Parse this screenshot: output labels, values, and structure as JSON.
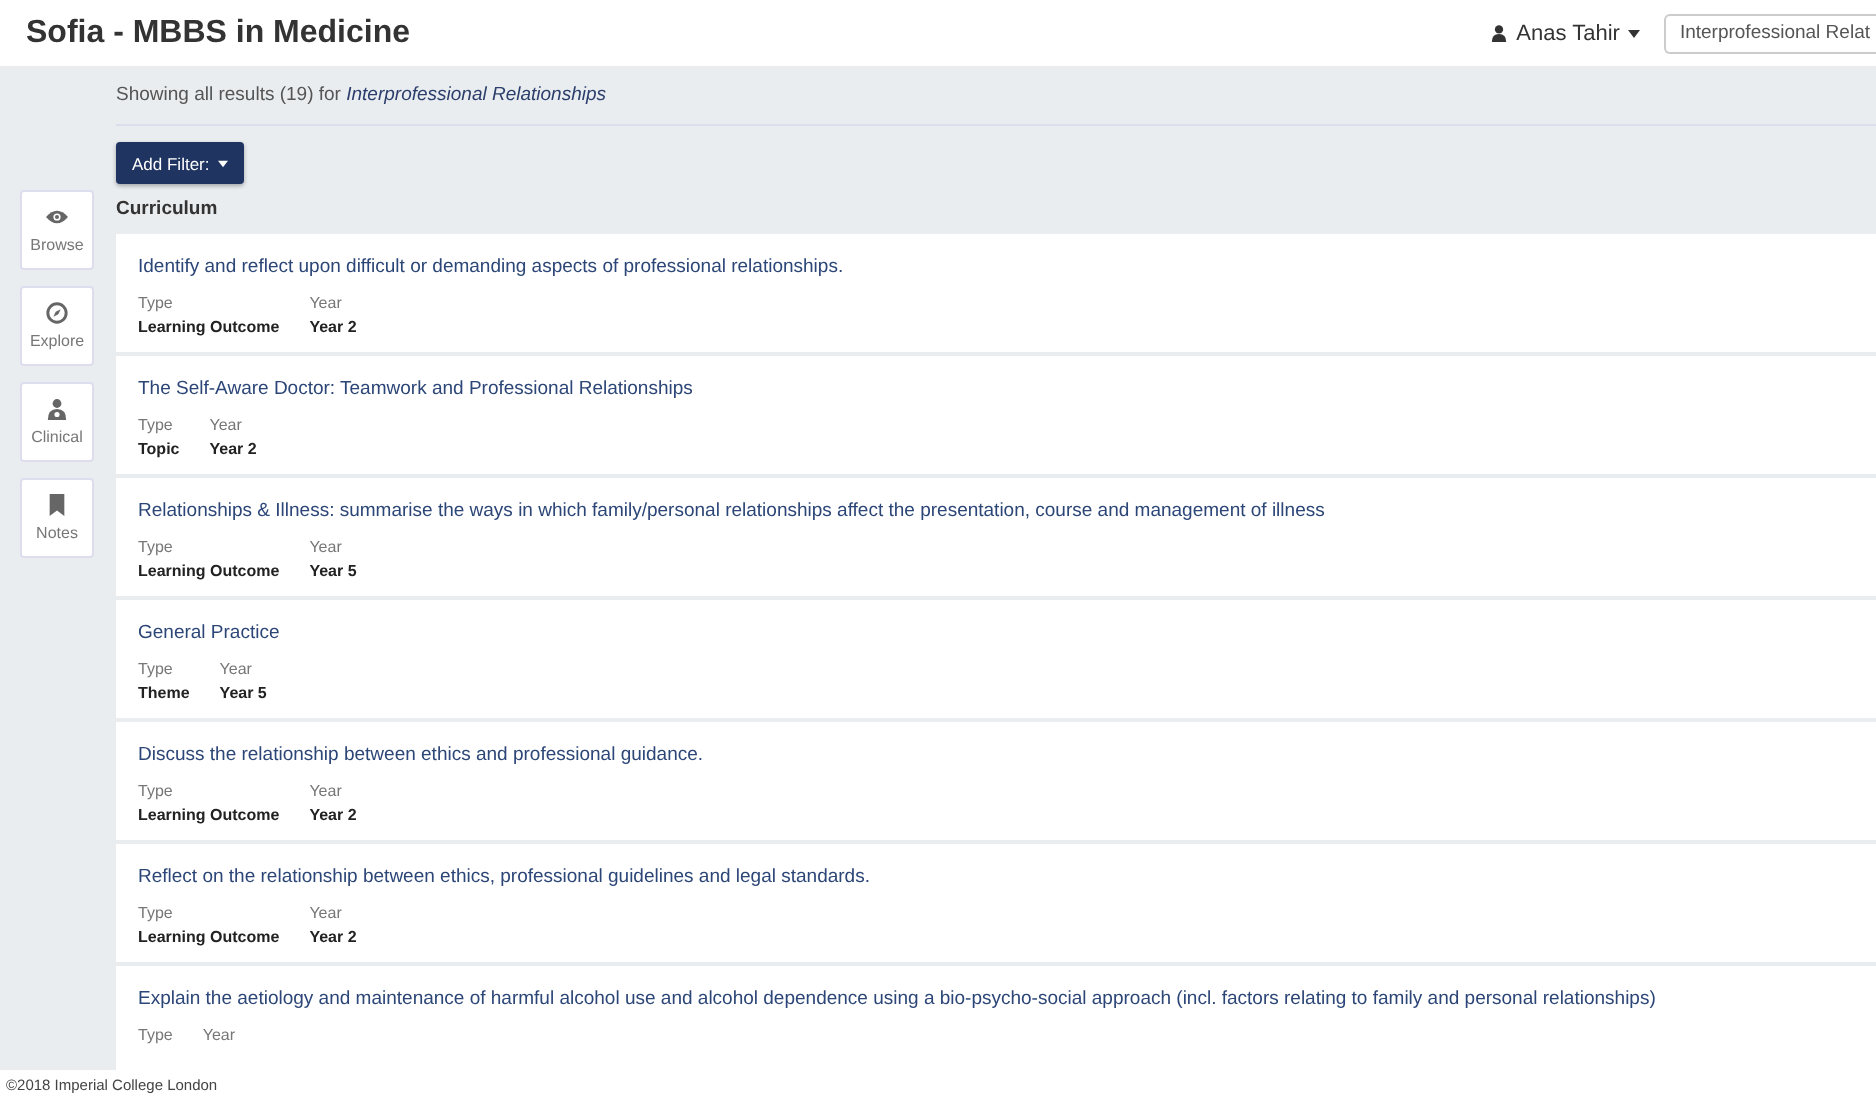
{
  "header": {
    "title": "Sofia - MBBS in Medicine",
    "user": "Anas Tahir",
    "search": {
      "value": "Interprofessional Relat"
    }
  },
  "sidebar": {
    "items": [
      {
        "label": "Browse",
        "kind": "eye"
      },
      {
        "label": "Explore",
        "kind": "compass"
      },
      {
        "label": "Clinical",
        "kind": "doctor"
      },
      {
        "label": "Notes",
        "kind": "bookmark"
      }
    ]
  },
  "results_summary": {
    "text": "Showing all results (19) for",
    "query": "Interprofessional Relationships"
  },
  "filter_button": "Add Filter:",
  "section_title": "Curriculum",
  "results": [
    {
      "title": "Identify and reflect upon difficult or demanding aspects of professional relationships.",
      "fields": [
        {
          "label": "Type",
          "value": "Learning Outcome"
        },
        {
          "label": "Year",
          "value": "Year 2"
        }
      ]
    },
    {
      "title": "The Self-Aware Doctor: Teamwork and Professional Relationships",
      "fields": [
        {
          "label": "Type",
          "value": "Topic"
        },
        {
          "label": "Year",
          "value": "Year 2"
        }
      ]
    },
    {
      "title": "Relationships & Illness: summarise the ways in which family/personal relationships affect the presentation, course and management of illness",
      "fields": [
        {
          "label": "Type",
          "value": "Learning Outcome"
        },
        {
          "label": "Year",
          "value": "Year 5"
        }
      ]
    },
    {
      "title": "General Practice",
      "fields": [
        {
          "label": "Type",
          "value": "Theme"
        },
        {
          "label": "Year",
          "value": "Year 5"
        }
      ]
    },
    {
      "title": "Discuss the relationship between ethics and professional guidance.",
      "fields": [
        {
          "label": "Type",
          "value": "Learning Outcome"
        },
        {
          "label": "Year",
          "value": "Year 2"
        }
      ]
    },
    {
      "title": "Reflect on the relationship between ethics, professional guidelines and legal standards.",
      "fields": [
        {
          "label": "Type",
          "value": "Learning Outcome"
        },
        {
          "label": "Year",
          "value": "Year 2"
        }
      ]
    },
    {
      "title": "Explain the aetiology and maintenance of harmful alcohol use and alcohol dependence using a bio-psycho-social approach (incl. factors relating to family and personal relationships)",
      "fields": [
        {
          "label": "Type"
        },
        {
          "label": "Year"
        }
      ]
    }
  ],
  "footer": "©2018 Imperial College London"
}
